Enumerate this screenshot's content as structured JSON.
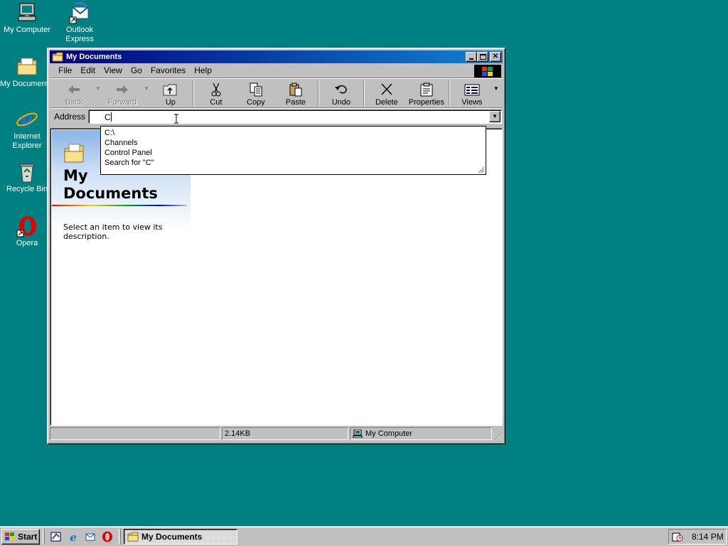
{
  "desktop": {
    "icons": [
      {
        "label": "My Computer",
        "icon": "my-computer-icon"
      },
      {
        "label": "Outlook Express",
        "line1": "Outlook",
        "line2": "Express",
        "icon": "outlook-express-icon"
      },
      {
        "label": "My Documents",
        "icon": "my-documents-icon"
      },
      {
        "label": "Internet Explorer",
        "line1": "Internet",
        "line2": "Explorer",
        "icon": "internet-explorer-icon"
      },
      {
        "label": "Recycle Bin",
        "icon": "recycle-bin-icon"
      },
      {
        "label": "Opera",
        "icon": "opera-icon"
      }
    ]
  },
  "window": {
    "title": "My Documents",
    "menu": [
      "File",
      "Edit",
      "View",
      "Go",
      "Favorites",
      "Help"
    ],
    "toolbar": {
      "back": "Back",
      "forward": "Forward",
      "up": "Up",
      "cut": "Cut",
      "copy": "Copy",
      "paste": "Paste",
      "undo": "Undo",
      "delete": "Delete",
      "properties": "Properties",
      "views": "Views"
    },
    "address": {
      "label": "Address",
      "value": "C"
    },
    "autocomplete": [
      "C:\\",
      "Channels",
      "Control Panel",
      "Search for \"C\""
    ],
    "pane": {
      "title_line1": "My",
      "title_line2": "Documents",
      "description": "Select an item to view its description."
    },
    "status": {
      "size": "2.14KB",
      "location": "My Computer"
    }
  },
  "taskbar": {
    "start": "Start",
    "task": "My Documents",
    "clock": "8:14 PM"
  },
  "colors": {
    "desktop": "#008080",
    "titlebar": "#000080",
    "face": "#c0c0c0"
  }
}
